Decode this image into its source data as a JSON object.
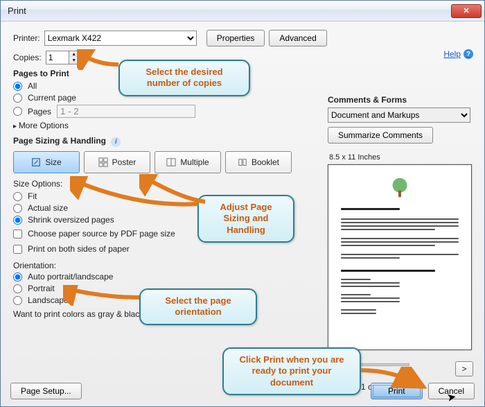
{
  "window": {
    "title": "Print"
  },
  "help": {
    "label": "Help"
  },
  "printer": {
    "label": "Printer:",
    "selected": "Lexmark X422",
    "properties": "Properties",
    "advanced": "Advanced"
  },
  "copies": {
    "label": "Copies:",
    "value": "1"
  },
  "pages_to_print": {
    "heading": "Pages to Print",
    "all": "All",
    "current": "Current page",
    "pages": "Pages",
    "pages_range": "1 - 2",
    "more": "More Options"
  },
  "sizing": {
    "heading": "Page Sizing & Handling",
    "size": "Size",
    "poster": "Poster",
    "multiple": "Multiple",
    "booklet": "Booklet",
    "options_label": "Size Options:",
    "fit": "Fit",
    "actual": "Actual size",
    "shrink": "Shrink oversized pages",
    "paper_source": "Choose paper source by PDF page size",
    "both_sides": "Print on both sides of paper"
  },
  "orientation": {
    "label": "Orientation:",
    "auto": "Auto portrait/landscape",
    "portrait": "Portrait",
    "landscape": "Landscape"
  },
  "gray": {
    "question": "Want to print colors as gray & black?"
  },
  "comments": {
    "heading": "Comments & Forms",
    "selected": "Document and Markups",
    "summarize": "Summarize Comments"
  },
  "preview": {
    "dimensions": "8.5 x 11 Inches",
    "page_of": "Page 1 of 2"
  },
  "footer": {
    "page_setup": "Page Setup...",
    "print": "Print",
    "cancel": "Cancel",
    "nav_right": ">"
  },
  "callouts": {
    "copies": "Select the desired number of copies",
    "sizing": "Adjust Page Sizing and Handling",
    "orientation": "Select the page orientation",
    "print": "Click Print when you are ready to print your document"
  }
}
